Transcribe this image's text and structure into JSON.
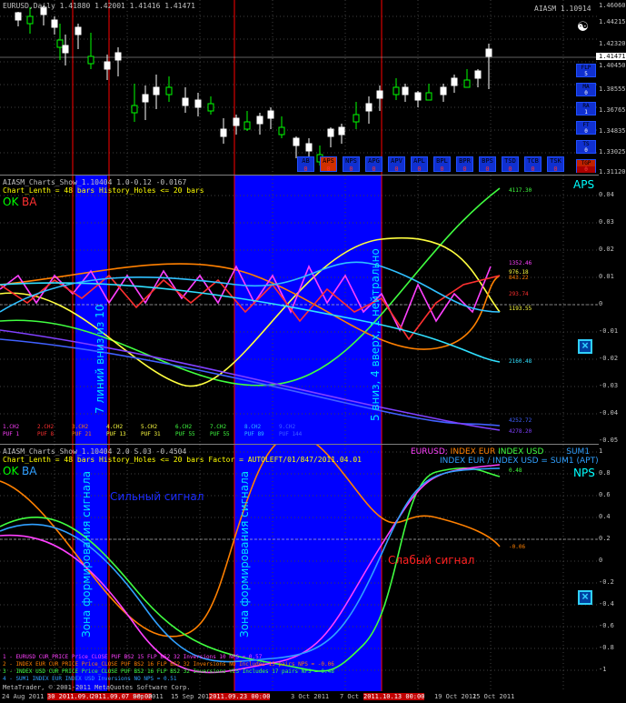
{
  "top_panel": {
    "symbol_line": "EURUSD,Daily  1.41880  1.42001 1.41416 1.41471",
    "right_label": "AIASM 1.10914",
    "yin_yang": "☯",
    "price_ticks": [
      "1.46060",
      "1.44215",
      "1.42320",
      "1.41471",
      "1.40450",
      "1.38555",
      "1.36765",
      "1.34835",
      "1.33025",
      "1.31120"
    ],
    "current_price": "1.41471",
    "side_buttons": [
      {
        "line1": "FLP",
        "line2": "5"
      },
      {
        "line1": "MA",
        "line2": "0"
      },
      {
        "line1": "RA",
        "line2": "1"
      },
      {
        "line1": "FT",
        "line2": "0"
      },
      {
        "line1": "TS",
        "line2": "0"
      },
      {
        "line1": "TGP",
        "line2": "0"
      }
    ],
    "bottom_buttons": [
      "AB",
      "APS",
      "NPS",
      "APG",
      "APV",
      "APL",
      "BPL",
      "BPR",
      "BPS",
      "TSD",
      "TCB",
      "TSK"
    ],
    "bottom_values": [
      "0",
      "0",
      "0",
      "0",
      "0",
      "0",
      "0",
      "0",
      "0",
      "0",
      "0",
      "0"
    ]
  },
  "mid_panel": {
    "title": "AIASM_Charts_Show_1.10404 1.0-0.12 -0.0167",
    "subtitle": "Chart_Lenth = 48 bars  History_Holes <= 20 bars",
    "ok_label": "OK",
    "ba_label": "BA",
    "corner_label": "APS",
    "y_ticks": [
      "0.04",
      "0.03",
      "0.02",
      "0.01",
      "0",
      "-0.01",
      "-0.02",
      "-0.03",
      "-0.04",
      "-0.05"
    ],
    "annotation_left": "7 линий вниз из 10",
    "annotation_right": "5 вниз, 4 вверх, 1 нейтрально",
    "right_values": [
      "4117.30",
      "1352.46",
      "976.18",
      "843.22",
      "293.74",
      "1193.55",
      "2160.48",
      "4252.72",
      "4278.20"
    ],
    "legend_row1": [
      "1.CH2",
      "2.CH2",
      "3.CH2",
      "4.CH2",
      "5.CH2",
      "6.CH2",
      "7.CH2",
      "8.CH2",
      "9.CH2"
    ],
    "legend_row2": [
      "PUF 1",
      "PUF 8",
      "PUF 21",
      "PUF 13",
      "PUF 31",
      "PUF 55",
      "PUF 55",
      "PUF 89",
      "PUF 144"
    ]
  },
  "bot_panel": {
    "title": "AIASM_Charts_Show_1.10404 2.0 S.03 -0.4504",
    "subtitle": "Chart_Lenth = 48 bars  History_Holes <= 20 bars  Factor = AUTOLEFT/01/847/2011.04.01",
    "ok_label": "OK",
    "ba_label": "BA",
    "corner_label": "NPS",
    "legend_top": {
      "eurusd": "EURUSD;",
      "index_eur": "INDEX EUR",
      "index_usd": "INDEX USD",
      "sum1": "SUM1"
    },
    "legend_second": "INDEX EUR / INDEX USD = SUM1 (APT)",
    "strong_signal": "Сильный сигнал",
    "weak_signal": "Слабый сигнал",
    "zone1": "Зона формирования сигнала",
    "zone2": "Зона формирования сигнала",
    "y_ticks": [
      "1",
      "0.8",
      "0.6",
      "0.4",
      "0.2",
      "0",
      "-0.2",
      "-0.4",
      "-0.6",
      "-0.8",
      "-1"
    ],
    "right_values": [
      "0.48",
      "-0.06"
    ],
    "info_rows": [
      "1 - EURUSD    CUR_PRICE  Price_CLOSE  PUF BS2 15   FLP BS2 32   Inversions 10    NPS = 0.57",
      "2 - INDEX EUR CUR_PRICE  Price_CLOSE  PUF BS2 16   FLP BS2 32   Inversions NO  Includes 15 pairs   NPS = -0.06",
      "3 - INDEX USD CUR_PRICE  Price_CLOSE  PUF BS2 16   FLP BS2 32   Inversions YES Includes 17 pairs   NPS = 0.48",
      "4 - SUM1      INDEX EUR  INDEX USD   Inversions NO   NPS = 0.51"
    ],
    "copyright": "MetaTrader, © 2001-2011 MetaQuotes Software Corp."
  },
  "x_axis": [
    {
      "label": "24 Aug 2011",
      "red": false
    },
    {
      "label": "30 2011.09.02 00:00",
      "red": true
    },
    {
      "label": "2011.09.07 00:00",
      "red": true
    },
    {
      "label": "Sep 2011",
      "red": false
    },
    {
      "label": "15 Sep 2011",
      "red": false
    },
    {
      "label": "2011.09.23 00:00",
      "red": true
    },
    {
      "label": "3 Oct 2011",
      "red": false
    },
    {
      "label": "7 Oct",
      "red": false
    },
    {
      "label": "2011.10.13 00:00",
      "red": true
    },
    {
      "label": "19 Oct 2011",
      "red": false
    },
    {
      "label": "25 Oct 2011",
      "red": false
    }
  ],
  "colors": {
    "zone": "#0000ff",
    "vline": "#ff0000",
    "grid": "#404040",
    "bull": "#ffffff",
    "bear": "#00ff00"
  }
}
